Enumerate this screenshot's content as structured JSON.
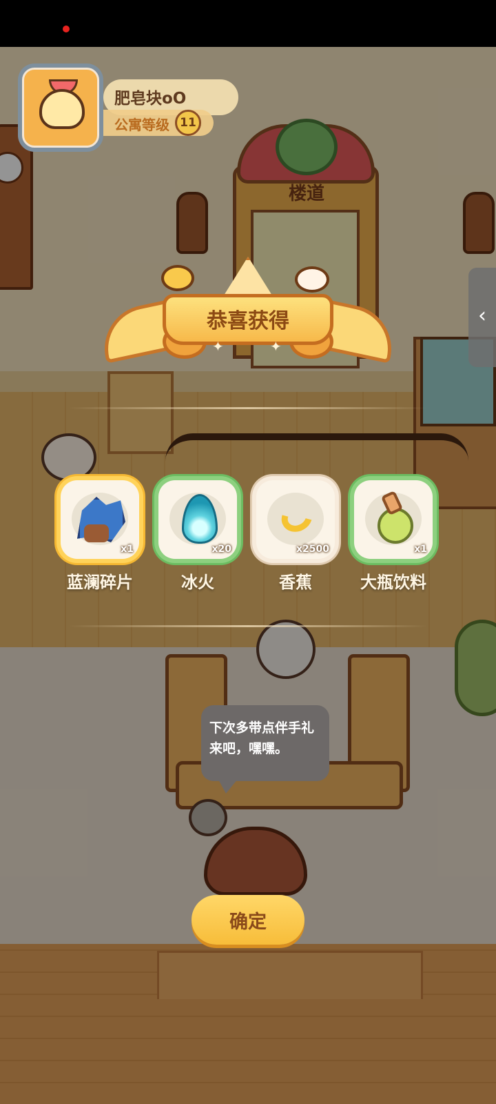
{
  "player": {
    "name": "肥皂块oO",
    "level_label": "公寓等级",
    "level": "11"
  },
  "scene": {
    "door_sign": "楼道"
  },
  "reward_popup": {
    "title": "恭喜获得",
    "items": [
      {
        "name": "蓝澜碎片",
        "count": "x1",
        "icon": "blue-shard-icon",
        "frame": "gold"
      },
      {
        "name": "冰火",
        "count": "x20",
        "icon": "ice-flame-icon",
        "frame": "green"
      },
      {
        "name": "香蕉",
        "count": "x2500",
        "icon": "banana-icon",
        "frame": "white"
      },
      {
        "name": "大瓶饮料",
        "count": "x1",
        "icon": "drink-bottle-icon",
        "frame": "green"
      }
    ],
    "confirm_label": "确定"
  },
  "npc_dialog": {
    "text": "下次多带点伴手礼来吧，嘿嘿。"
  },
  "side_panel": {
    "arrow_glyph": "‹"
  },
  "colors": {
    "banner_gold": "#f7b94a",
    "confirm_button": "#ffd768",
    "status_dot": "#e8231f"
  }
}
